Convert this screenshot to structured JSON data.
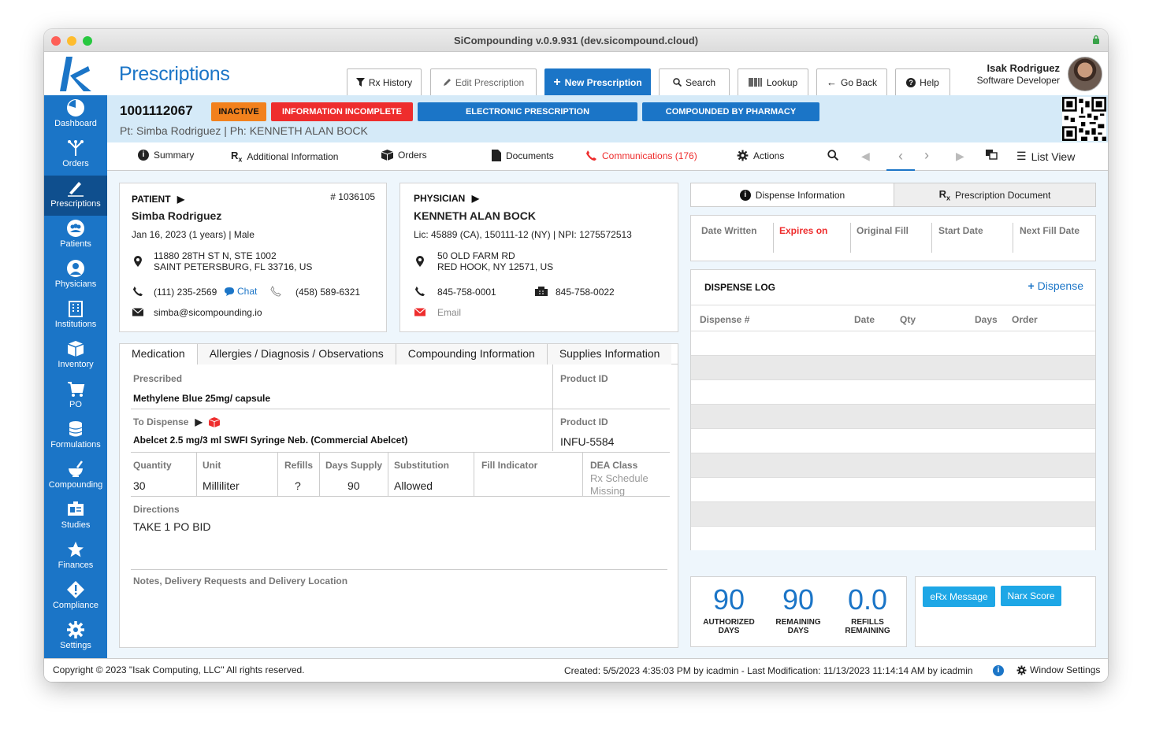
{
  "window": {
    "title": "SiCompounding v.0.9.931 (dev.sicompound.cloud)"
  },
  "app": {
    "title": "Prescriptions"
  },
  "toolbar": {
    "rx_history": "Rx History",
    "edit": "Edit Prescription",
    "new": "New Prescription",
    "search": "Search",
    "lookup": "Lookup",
    "go_back": "Go Back",
    "help": "Help"
  },
  "user": {
    "name": "Isak Rodriguez",
    "role": "Software Developer"
  },
  "sidebar": {
    "items": [
      {
        "label": "Dashboard"
      },
      {
        "label": "Orders"
      },
      {
        "label": "Prescriptions"
      },
      {
        "label": "Patients"
      },
      {
        "label": "Physicians"
      },
      {
        "label": "Institutions"
      },
      {
        "label": "Inventory"
      },
      {
        "label": "PO"
      },
      {
        "label": "Formulations"
      },
      {
        "label": "Compounding"
      },
      {
        "label": "Studies"
      },
      {
        "label": "Finances"
      },
      {
        "label": "Compliance"
      },
      {
        "label": "Settings"
      }
    ]
  },
  "banner": {
    "rx_number": "1001112067",
    "badges": {
      "inactive": "INACTIVE",
      "incomplete": "INFORMATION INCOMPLETE",
      "electronic": "ELECTRONIC PRESCRIPTION",
      "compounded": "COMPOUNDED BY PHARMACY"
    },
    "pt_line": "Pt: Simba Rodriguez | Ph: KENNETH ALAN BOCK"
  },
  "tabs": {
    "summary": "Summary",
    "additional": "Additional Information",
    "orders": "Orders",
    "documents": "Documents",
    "communications": "Communications (176)",
    "actions": "Actions",
    "list_view": "List View"
  },
  "patient": {
    "heading": "PATIENT",
    "id": "# 1036105",
    "name": "Simba Rodriguez",
    "dob": "Jan 16, 2023 (1 years) | Male",
    "address1": "11880 28TH ST N, STE 1002",
    "address2": "SAINT PETERSBURG, FL 33716, US",
    "phone": "(111) 235-2569",
    "chat": "Chat",
    "phone2": "(458) 589-6321",
    "email": "simba@sicompounding.io"
  },
  "physician": {
    "heading": "PHYSICIAN",
    "name": "KENNETH ALAN BOCK",
    "lic": "Lic: 45889 (CA), 150111-12 (NY)  | NPI: 1275572513",
    "address1": "50 OLD FARM RD",
    "address2": "RED HOOK, NY 12571, US",
    "phone": "845-758-0001",
    "fax": "845-758-0022",
    "email": "Email"
  },
  "med_tabs": [
    "Medication",
    "Allergies / Diagnosis / Observations",
    "Compounding Information",
    "Supplies Information"
  ],
  "medication": {
    "prescribed_label": "Prescribed",
    "prescribed": "Methylene Blue 25mg/ capsule",
    "product_id_label": "Product ID",
    "product_id_1": "",
    "to_dispense_label": "To Dispense",
    "to_dispense": "Abelcet 2.5 mg/3 ml SWFI Syringe Neb. (Commercial Abelcet)",
    "product_id_2": "INFU-5584",
    "quantity_label": "Quantity",
    "quantity": "30",
    "unit_label": "Unit",
    "unit": "Milliliter",
    "refills_label": "Refills",
    "refills": "?",
    "days_supply_label": "Days Supply",
    "days_supply": "90",
    "substitution_label": "Substitution",
    "substitution": "Allowed",
    "fill_indicator_label": "Fill Indicator",
    "dea_label": "DEA Class",
    "dea_line1": "Rx Schedule",
    "dea_line2": "Missing",
    "directions_label": "Directions",
    "directions": "TAKE 1 PO BID",
    "notes_label": "Notes, Delivery Requests and Delivery Location"
  },
  "dispense_tabs": {
    "info": "Dispense Information",
    "document": "Prescription Document"
  },
  "dates": {
    "written": "Date Written",
    "expires": "Expires on",
    "original": "Original Fill",
    "start": "Start Date",
    "next": "Next Fill Date"
  },
  "dispense_log": {
    "title": "DISPENSE LOG",
    "add": "Dispense",
    "columns": {
      "num": "Dispense #",
      "date": "Date",
      "qty": "Qty",
      "days": "Days",
      "order": "Order"
    }
  },
  "stats": [
    {
      "value": "90",
      "cap1": "AUTHORIZED",
      "cap2": "DAYS"
    },
    {
      "value": "90",
      "cap1": "REMAINING",
      "cap2": "DAYS"
    },
    {
      "value": "0.0",
      "cap1": "REFILLS",
      "cap2": "REMAINING"
    }
  ],
  "actions": {
    "erx": "eRx Message",
    "narx": "Narx Score"
  },
  "footer": {
    "copyright": "Copyright © 2023 \"Isak Computing, LLC\" All rights reserved.",
    "created": "Created: 5/5/2023 4:35:03 PM by icadmin - Last Modification: 11/13/2023 11:14:14 AM  by icadmin",
    "window_settings": "Window Settings"
  },
  "colors": {
    "brand": "#1b75c7",
    "orange": "#f2811d",
    "red": "#ee2d2d",
    "banner": "#d5eaf8",
    "link": "#1ea7e6"
  }
}
